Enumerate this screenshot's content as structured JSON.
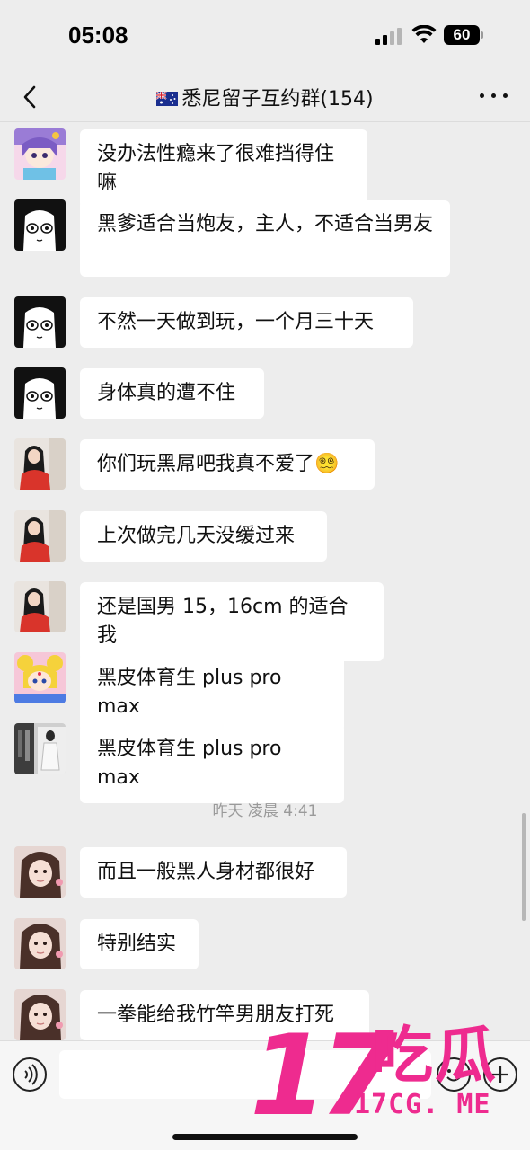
{
  "status_bar": {
    "time": "05:08",
    "battery": "60"
  },
  "header": {
    "title": "悉尼留子互约群(154)"
  },
  "messages": [
    {
      "text": "没办法性瘾来了很难挡得住嘛",
      "avatar": "anime-purple-hair-avatar"
    },
    {
      "text": "黑爹适合当炮友，主人，不适合当男友",
      "avatar": "manga-girl-avatar"
    },
    {
      "text": "不然一天做到玩，一个月三十天",
      "avatar": "manga-girl-avatar"
    },
    {
      "text": "身体真的遭不住",
      "avatar": "manga-girl-avatar"
    },
    {
      "text": "你们玩黑屌吧我真不爱了",
      "avatar": "red-dress-girl-avatar",
      "emoji": "😵‍💫"
    },
    {
      "text": "上次做完几天没缓过来",
      "avatar": "red-dress-girl-avatar"
    },
    {
      "text": "还是国男 15，16cm 的适合我",
      "avatar": "red-dress-girl-avatar"
    },
    {
      "text": "黑皮体育生 plus pro max",
      "avatar": "sailor-moon-avatar"
    },
    {
      "text": "黑皮体育生 plus pro max",
      "avatar": "photo-wardrobe-avatar"
    },
    {
      "text": "而且一般黑人身材都很好",
      "avatar": "selfie-girl-avatar"
    },
    {
      "text": "特别结实",
      "avatar": "selfie-girl-avatar"
    },
    {
      "text": "一拳能给我竹竿男朋友打死",
      "avatar": "selfie-girl-avatar"
    }
  ],
  "time_separator": "昨天 凌晨 4:41",
  "watermark": {
    "number": "17",
    "chinese": "吃瓜",
    "domain": "17CG. ME"
  },
  "colors": {
    "background": "#ededed",
    "bubble": "#ffffff",
    "watermark": "#ee2b8f"
  }
}
